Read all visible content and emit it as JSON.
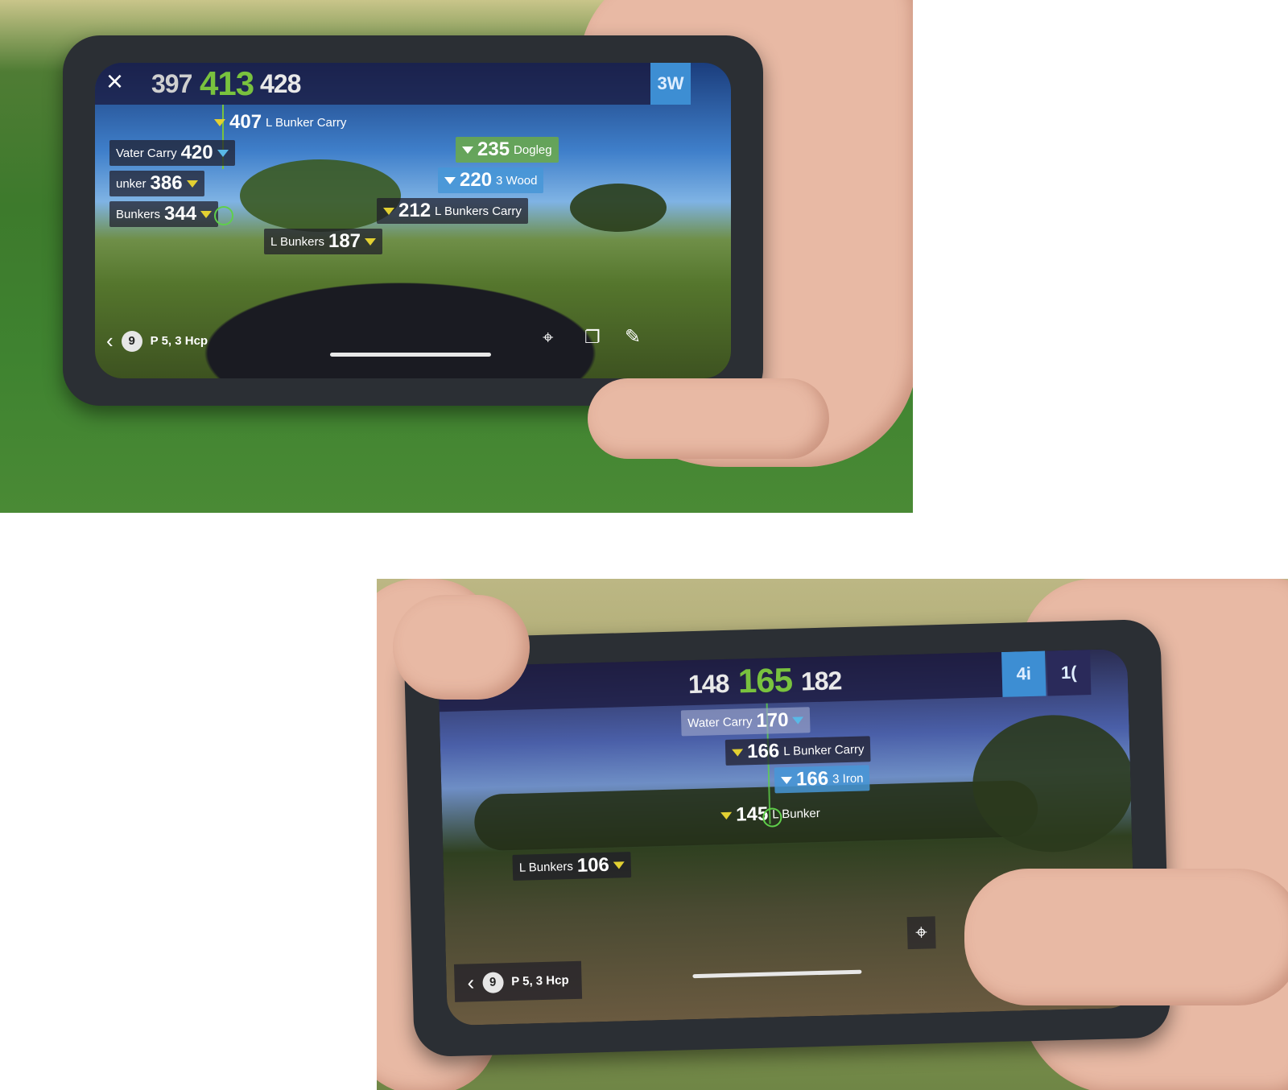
{
  "top": {
    "close_icon": "×",
    "distances": {
      "front": "397",
      "center": "413",
      "back": "428"
    },
    "club": "3W",
    "labels": [
      {
        "num": "407",
        "text": "L Bunker Carry"
      },
      {
        "prefix": "Vater Carry",
        "num": "420"
      },
      {
        "prefix": "unker",
        "num": "386"
      },
      {
        "prefix": "Bunkers",
        "num": "344"
      },
      {
        "prefix": "L Bunkers",
        "num": "187"
      },
      {
        "num": "235",
        "text": "Dogleg"
      },
      {
        "num": "220",
        "text": "3 Wood"
      },
      {
        "num": "212",
        "text": "L Bunkers Carry"
      }
    ],
    "hole_number": "9",
    "hole_info": "P 5, 3 Hcp",
    "icons": [
      "back-chevron-icon",
      "locate-icon",
      "layers-icon",
      "pencil-icon"
    ]
  },
  "bottom": {
    "distances": {
      "front": "148",
      "center": "165",
      "back": "182"
    },
    "clubs": [
      "4i",
      "1("
    ],
    "labels": [
      {
        "prefix": "Water Carry",
        "num": "170"
      },
      {
        "num": "166",
        "text": "L Bunker Carry"
      },
      {
        "num": "166",
        "text": "3 Iron"
      },
      {
        "num": "145",
        "text": "L Bunker"
      },
      {
        "prefix": "L Bunkers",
        "num": "106"
      }
    ],
    "hole_number": "9",
    "hole_info": "P 5, 3 Hcp",
    "icons": [
      "back-chevron-icon",
      "locate-icon"
    ]
  }
}
